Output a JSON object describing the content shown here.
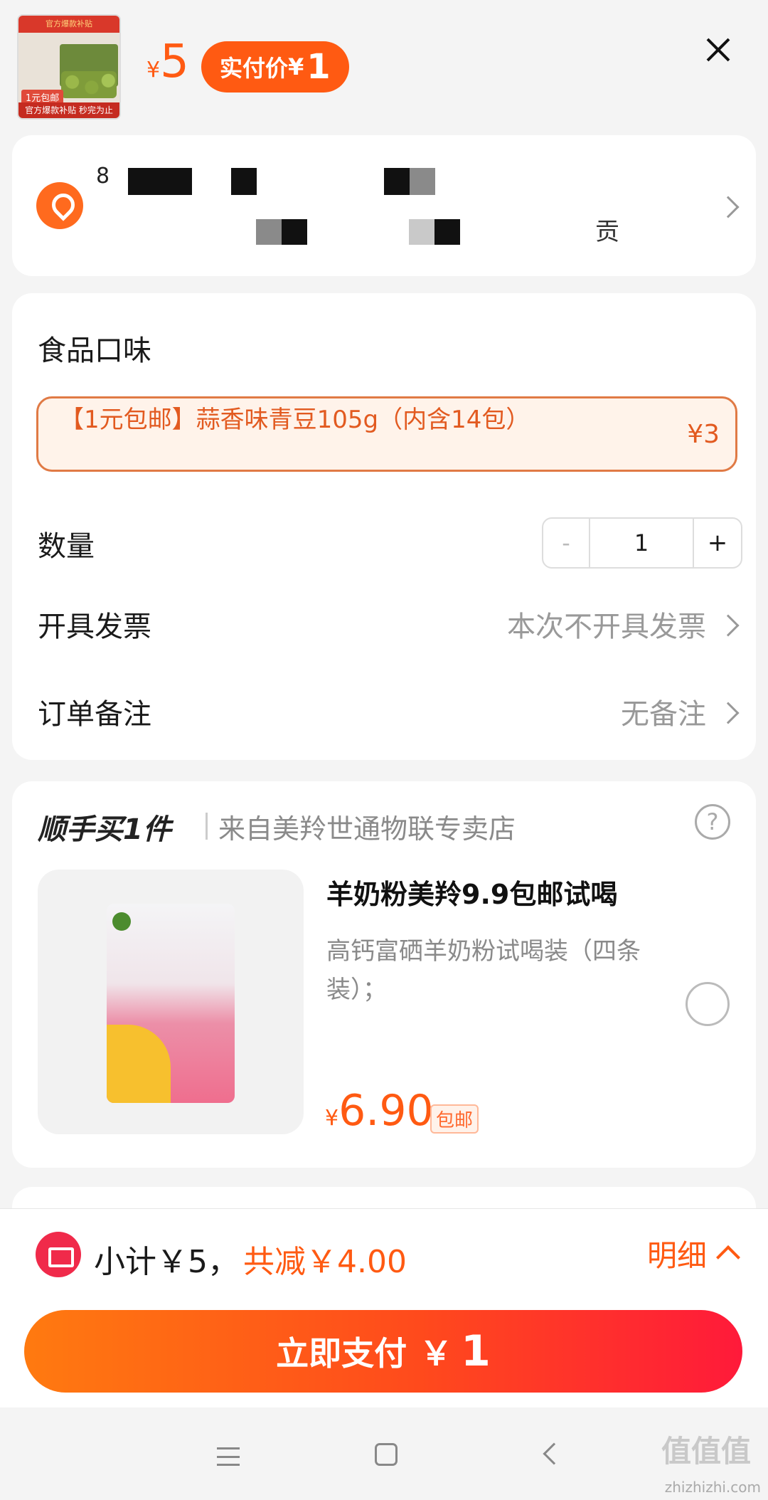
{
  "header": {
    "thumb": {
      "top_banner": "官方爆款补贴",
      "tag": "1元包邮",
      "bottom_banner": "官方爆款补贴 秒完为止"
    },
    "price_yen": "¥",
    "price": "5",
    "paid_label": "实付价",
    "paid_yen": "¥",
    "paid_amount": "1"
  },
  "address": {
    "first_char": "8",
    "tail_text": "贡"
  },
  "options": {
    "flavor_label": "食品口味",
    "flavor_option": "【1元包邮】蒜香味青豆105g（内含14包）",
    "flavor_price": "¥3",
    "quantity_label": "数量",
    "quantity_minus": "-",
    "quantity_value": "1",
    "quantity_plus": "+",
    "invoice_label": "开具发票",
    "invoice_value": "本次不开具发票",
    "note_label": "订单备注",
    "note_value": "无备注"
  },
  "addon": {
    "title": "顺手买1件",
    "shop": "来自美羚世通物联专卖店",
    "help": "?",
    "product_title": "羊奶粉美羚9.9包邮试喝",
    "product_desc": "高钙富硒羊奶粉试喝装（四条装）；",
    "price_yen": "¥",
    "price": "6.90",
    "free_ship": "包邮"
  },
  "footer": {
    "subtotal": "小计￥5，",
    "savings": "共减￥4.00",
    "detail": "明细",
    "pay_label": "立即支付",
    "pay_yen": "￥",
    "pay_amount": "1"
  },
  "watermark": "zhizhizhi.com",
  "colors": {
    "accent": "#ff5a12",
    "pay_gradient_end": "#ff1a3a"
  }
}
